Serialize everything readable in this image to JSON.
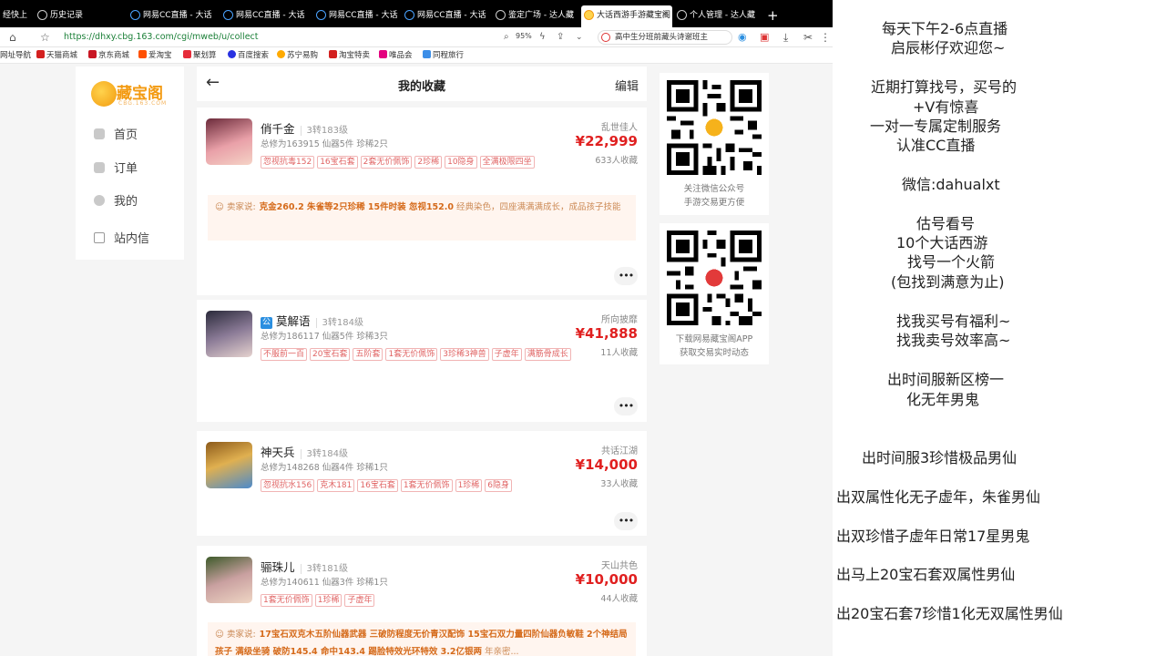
{
  "browser": {
    "tabs": [
      {
        "label": "经快上"
      },
      {
        "label": "历史记录"
      },
      {
        "label": "网易CC直播 - 大话"
      },
      {
        "label": "网易CC直播 - 大话"
      },
      {
        "label": "网易CC直播 - 大话"
      },
      {
        "label": "网易CC直播 - 大话"
      },
      {
        "label": "鉴定广场 - 达人藏"
      },
      {
        "label": "大话西游手游藏宝阁"
      },
      {
        "label": "个人管理 - 达人藏"
      }
    ],
    "new_tab": "+",
    "url": "https://dhxy.cbg.163.com/cgi/mweb/u/collect",
    "zoom": "95%",
    "hot_search": "高中生分班前藏头诗谢班主",
    "bookmarks": [
      "网址导航",
      "天猫商城",
      "京东商城",
      "爱淘宝",
      "聚划算",
      "百度搜索",
      "苏宁易购",
      "淘宝特卖",
      "唯品会",
      "同程旅行"
    ]
  },
  "sidenav": {
    "logo_text": "藏宝阁",
    "logo_sub": "CBG.163.COM",
    "items": [
      {
        "label": "首页"
      },
      {
        "label": "订单"
      },
      {
        "label": "我的"
      },
      {
        "label": "站内信"
      }
    ]
  },
  "main": {
    "title": "我的收藏",
    "edit": "编辑",
    "cards": [
      {
        "name": "俏千金",
        "level": "3转183级",
        "info": "总修为163915  仙器5件  珍稀2只",
        "tags": [
          "忽视抗毒152",
          "16宝石套",
          "2套无价佩饰",
          "2珍稀",
          "10隐身",
          "全满极限四坐"
        ],
        "server": "乱世佳人",
        "price": "¥22,999",
        "favs": "633人收藏",
        "note_label": "卖家说:",
        "note_bold": "克金260.2 朱雀等2只珍稀 15件时装 忽视152.0",
        "note_rest": "经典染色，四座满满满成长，成品孩子技能",
        "official": false
      },
      {
        "name": "莫解语",
        "level": "3转184级",
        "badge": "公",
        "info": "总修为186117  仙器5件  珍稀3只",
        "tags": [
          "不服前一百",
          "20宝石套",
          "五阶套",
          "1套无价佩饰",
          "3珍稀3神兽",
          "子虚年",
          "满筋骨成长"
        ],
        "server": "所向披靡",
        "price": "¥41,888",
        "favs": "11人收藏",
        "official": true
      },
      {
        "name": "神天兵",
        "level": "3转184级",
        "info": "总修为148268  仙器4件  珍稀1只",
        "tags": [
          "忽视抗水156",
          "克木181",
          "16宝石套",
          "1套无价佩饰",
          "1珍稀",
          "6隐身"
        ],
        "server": "共话江湖",
        "price": "¥14,000",
        "favs": "33人收藏",
        "official": false
      },
      {
        "name": "骊珠儿",
        "level": "3转181级",
        "info": "总修为140611  仙器3件  珍稀1只",
        "tags": [
          "1套无价佩饰",
          "1珍稀",
          "子虚年"
        ],
        "server": "天山共色",
        "price": "¥10,000",
        "favs": "44人收藏",
        "note_label": "卖家说:",
        "note_bold": "17宝石双克木五阶仙器武器 三破防程度无价青汉配饰 15宝石双力量四阶仙器负敏鞋 2个神结局孩子 满级坐骑 破防145.4 命中143.4 踢脸特效光环特效 3.2亿银两",
        "note_rest": "年亲密...",
        "official": false
      }
    ]
  },
  "qr": [
    {
      "caption1": "关注微信公众号",
      "caption2": "手游交易更方便"
    },
    {
      "caption1": "下载网易藏宝阁APP",
      "caption2": "获取交易实时动态"
    }
  ],
  "overlay": {
    "lines": [
      "每天下午2-6点直播",
      "启辰彬仔欢迎您~",
      "近期打算找号，买号的",
      "+V有惊喜",
      "一对一专属定制服务",
      "认准CC直播",
      "微信:dahualxt",
      "估号看号",
      "10个大话西游",
      "找号一个火箭",
      "(包找到满意为止)",
      "找我买号有福利~",
      "找我卖号效率高~",
      "出时间服新区榜一",
      "化无年男鬼",
      "出时间服3珍惜极品男仙",
      "出双属性化无子虚年，朱雀男仙",
      "出双珍惜子虚年日常17星男鬼",
      "出马上20宝石套双属性男仙",
      "出20宝石套7珍惜1化无双属性男仙"
    ]
  },
  "colors": {
    "price": "#e02020",
    "tag": "#e06464",
    "url": "#1a7f37",
    "accent": "#f39a10"
  }
}
